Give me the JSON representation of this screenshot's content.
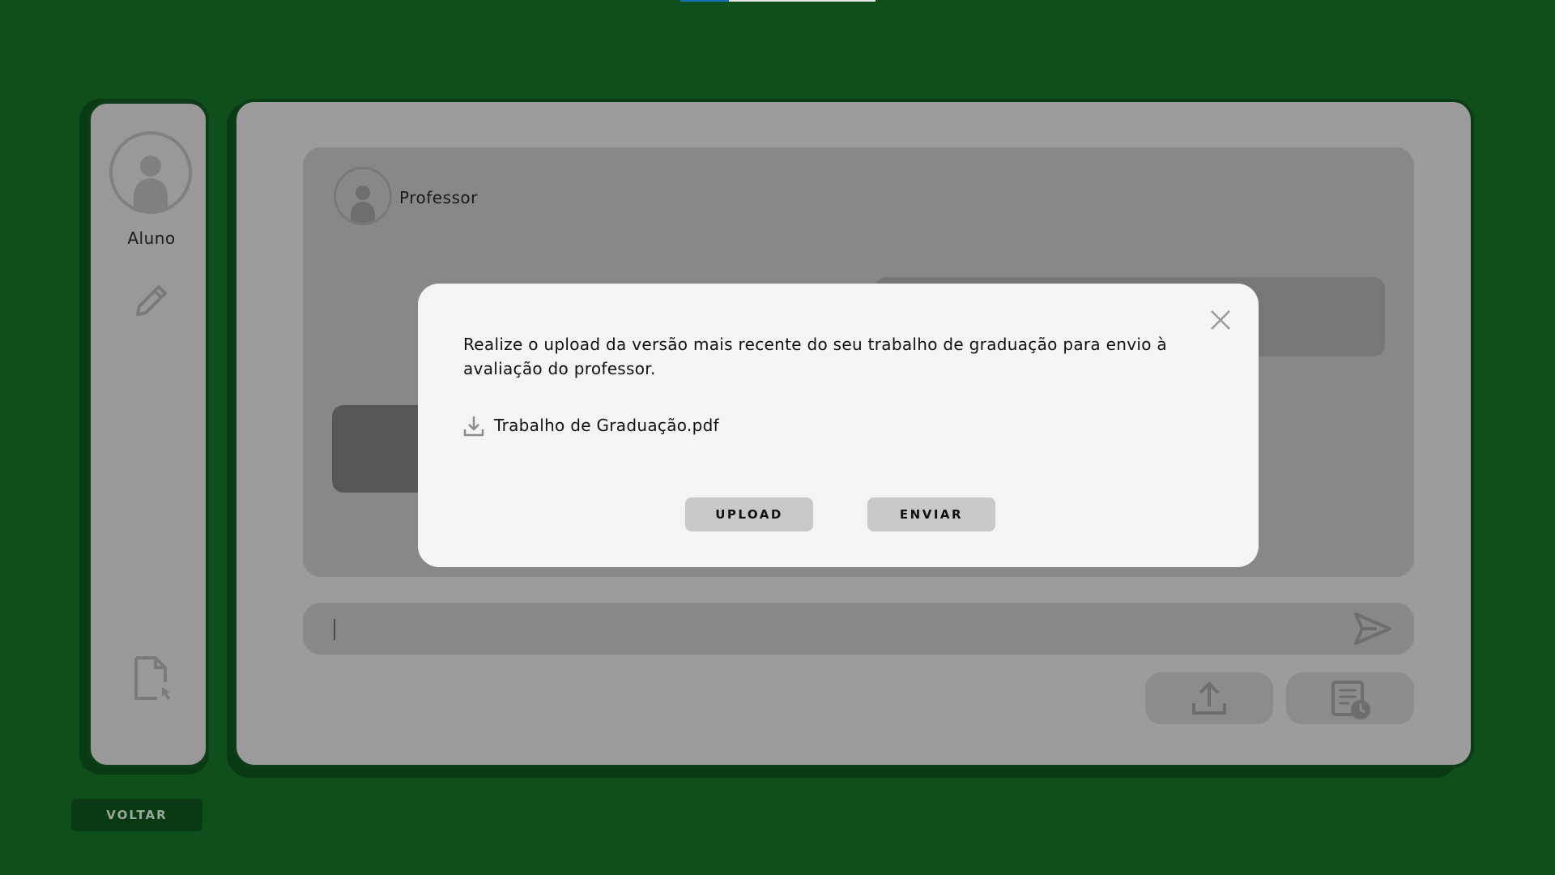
{
  "progress": {
    "value_percent": 25,
    "fill_color": "#1d6fb8",
    "track_color": "#e6e6e6"
  },
  "sidebar": {
    "user_label": "Aluno",
    "icons": [
      "avatar",
      "pencil-icon",
      "file-cursor-icon"
    ]
  },
  "footer": {
    "back_label": "VOLTAR"
  },
  "chat": {
    "contact_name": "Professor",
    "input_value": ""
  },
  "actions": {
    "upload_icon": "upload-icon",
    "history_icon": "document-clock-icon"
  },
  "modal": {
    "message": "Realize o upload da versão mais recente do seu trabalho de graduação para envio à avaliação do professor.",
    "file_name": "Trabalho de Graduação.pdf",
    "upload_label": "UPLOAD",
    "send_label": "ENVIAR"
  },
  "colors": {
    "background": "#0f4f1c",
    "panel": "#9c9c9c",
    "modal": "#f4f4f4",
    "modal_button": "#c8c8c8"
  }
}
